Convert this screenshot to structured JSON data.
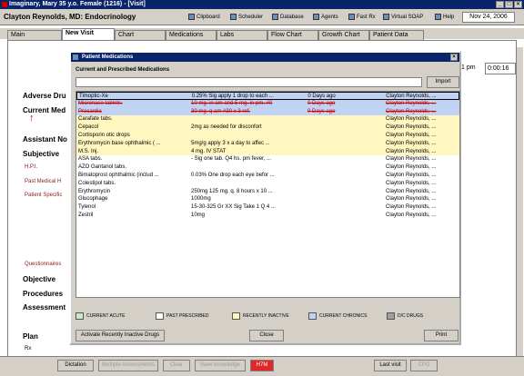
{
  "window": {
    "title": "Imaginary, Mary 35 y.o. Female (1216) - [Visit]"
  },
  "header": {
    "doctor": "Clayton Reynolds, MD: Endocrinology",
    "tools": [
      {
        "label": "Clipboard",
        "icon": "clipboard-icon"
      },
      {
        "label": "Scheduler",
        "icon": "scheduler-icon"
      },
      {
        "label": "Database",
        "icon": "database-icon"
      },
      {
        "label": "Agents",
        "icon": "agents-icon"
      },
      {
        "label": "Fast Rx",
        "icon": "fast-rx-icon"
      },
      {
        "label": "Virtual SOAP",
        "icon": "virtual-soap-icon"
      },
      {
        "label": "Help",
        "icon": "help-icon"
      }
    ],
    "date": "Nov 24, 2006"
  },
  "tabs": [
    "Main",
    "New Visit",
    "Chart",
    "Medications",
    "Labs",
    "Flow Chart",
    "Growth Chart",
    "Patient Data"
  ],
  "visit": {
    "time_label": "1 pm",
    "timer": "0:00:16",
    "sections": {
      "adverse": "Adverse Dru",
      "current": "Current Med",
      "assistant": "Assistant No",
      "subjective": "Subjective",
      "hpi": "H.P.I.",
      "pmh": "Past Medical H",
      "patient_specific": "Patient Specific",
      "questionnaires": "Questionnaires",
      "objective": "Objective",
      "procedures": "Procedures",
      "assessment": "Assessment",
      "plan": "Plan",
      "rx": "Rx"
    }
  },
  "dialog": {
    "title": "Patient Medications",
    "subtitle": "Current and Prescribed Medications",
    "import_label": "Import",
    "rows": [
      {
        "name": "Timoptic-Xe",
        "sig": "0.25% Sig apply 1 drop to each ...",
        "when": "0 Days ago",
        "doctor": "Clayton Reynolds, ...",
        "kind": "chronic",
        "selected": true
      },
      {
        "name": "Micronase tablets.",
        "sig": "10 mg. in am and 5 mg. in pm.  #0",
        "when": "0 Days ago",
        "doctor": "Clayton Reynolds, ...",
        "kind": "chronic-struck"
      },
      {
        "name": "Procardia",
        "sig": "30 mg. q am  #30 x 3 ref.",
        "when": "0 Days ago",
        "doctor": "Clayton Reynolds, ...",
        "kind": "chronic-struck"
      },
      {
        "name": "Carafate tabs.",
        "sig": "",
        "when": "",
        "doctor": "Clayton Reynolds, ...",
        "kind": "inactive"
      },
      {
        "name": "Cepacol",
        "sig": "2mg as needed for disconfort",
        "when": "",
        "doctor": "Clayton Reynolds, ...",
        "kind": "inactive"
      },
      {
        "name": "Cortisporin otic drops",
        "sig": "",
        "when": "",
        "doctor": "Clayton Reynolds, ...",
        "kind": "inactive"
      },
      {
        "name": "Erythromycin base ophthalmic ( ...",
        "sig": "5mg/g apply 3 x a day to affec ...",
        "when": "",
        "doctor": "Clayton Reynolds, ...",
        "kind": "inactive"
      },
      {
        "name": "M.S. Inj.",
        "sig": "4 mg. IV STAT",
        "when": "",
        "doctor": "Clayton Reynolds, ...",
        "kind": "inactive"
      },
      {
        "name": "ASA tabs.",
        "sig": "- Sig one tab. Q4 hs. pm fever, ...",
        "when": "",
        "doctor": "Clayton Reynolds, ...",
        "kind": "past"
      },
      {
        "name": "AZO Gantanol tabs.",
        "sig": "",
        "when": "",
        "doctor": "Clayton Reynolds, ...",
        "kind": "past"
      },
      {
        "name": "Bimatoprost ophthalmic (includ ...",
        "sig": "0.03% One drop each eye befor ...",
        "when": "",
        "doctor": "Clayton Reynolds, ...",
        "kind": "past"
      },
      {
        "name": "Colestipol tabs.",
        "sig": "",
        "when": "",
        "doctor": "Clayton Reynolds, ...",
        "kind": "past"
      },
      {
        "name": "Erythromycin",
        "sig": "250mg 125 mg. q. 8 hours x 10 ...",
        "when": "",
        "doctor": "Clayton Reynolds, ...",
        "kind": "past"
      },
      {
        "name": "Glucophage",
        "sig": "1000mg",
        "when": "",
        "doctor": "Clayton Reynolds, ...",
        "kind": "past"
      },
      {
        "name": "Tylenol",
        "sig": "15-30-325 Gr XX Sig Take 1 Q 4 ...",
        "when": "",
        "doctor": "Clayton Reynolds, ...",
        "kind": "past"
      },
      {
        "name": "Zestril",
        "sig": "10mg",
        "when": "",
        "doctor": "Clayton Reynolds, ...",
        "kind": "past"
      }
    ],
    "legend": [
      {
        "label": "CURRENT ACUTE",
        "color": "#c8e8c8"
      },
      {
        "label": "PAST PRESCRIBED",
        "color": "#ffffff"
      },
      {
        "label": "RECENTLY INACTIVE",
        "color": "#fff6c0"
      },
      {
        "label": "CURRENT CHRONICS",
        "color": "#c1d3f3"
      },
      {
        "label": "D/C DRUGS",
        "color": "#a0a0a0"
      }
    ],
    "buttons": {
      "activate": "Activate Recently Inactive Drugs",
      "close": "Close",
      "print": "Print"
    }
  },
  "bottom": {
    "dictation": "Dictation",
    "multiple": "Multiple Assessments",
    "clear": "Clear",
    "save_knowledge": "Save knowledge",
    "htm": "H7M",
    "last_visit": "Last visit",
    "cpo": "CPO"
  }
}
